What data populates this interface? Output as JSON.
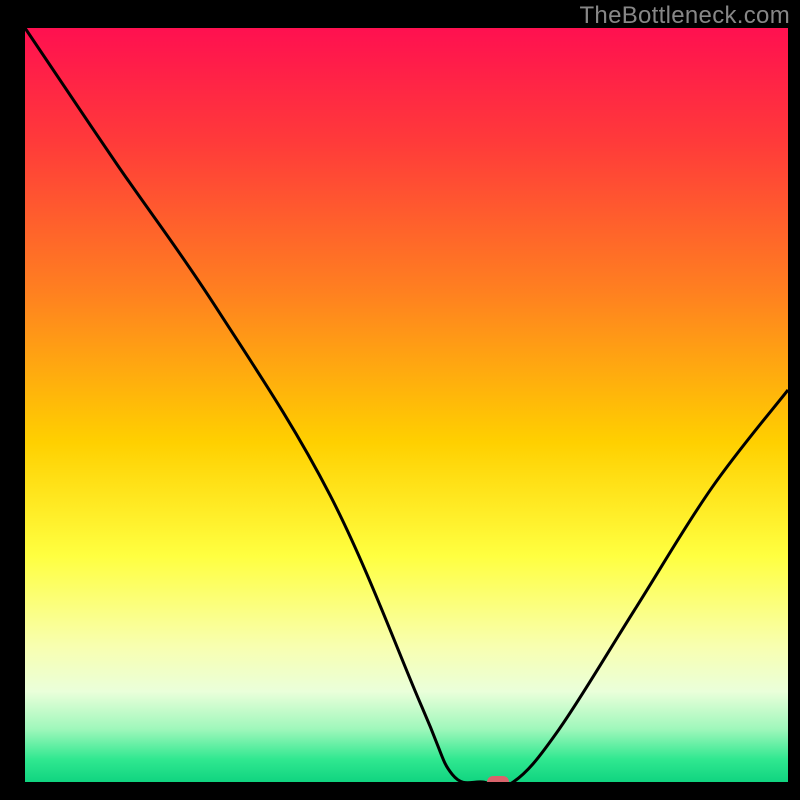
{
  "watermark": "TheBottleneck.com",
  "chart_data": {
    "type": "line",
    "title": "",
    "xlabel": "",
    "ylabel": "",
    "xlim": [
      0,
      100
    ],
    "ylim": [
      0,
      100
    ],
    "x": [
      0,
      12,
      25,
      40,
      52,
      56,
      60,
      64,
      70,
      80,
      90,
      100
    ],
    "values": [
      100,
      82,
      63,
      38,
      10,
      1,
      0,
      0,
      7,
      23,
      39,
      52
    ],
    "series_name": "bottleneck-curve",
    "marker": {
      "x": 62,
      "y": 0
    },
    "gradient_stops": [
      {
        "offset": 0.0,
        "color": "#ff1050"
      },
      {
        "offset": 0.15,
        "color": "#ff3a3a"
      },
      {
        "offset": 0.35,
        "color": "#ff8020"
      },
      {
        "offset": 0.55,
        "color": "#ffd000"
      },
      {
        "offset": 0.7,
        "color": "#ffff40"
      },
      {
        "offset": 0.82,
        "color": "#f8ffb0"
      },
      {
        "offset": 0.88,
        "color": "#eaffda"
      },
      {
        "offset": 0.93,
        "color": "#9ef7bb"
      },
      {
        "offset": 0.97,
        "color": "#30e890"
      },
      {
        "offset": 1.0,
        "color": "#10d480"
      }
    ],
    "frame": {
      "thickness_top": 28,
      "thickness_left": 25,
      "thickness_right": 12,
      "thickness_bottom": 18
    },
    "marker_style": {
      "fill": "#d9636b",
      "rx": 6,
      "w": 22,
      "h": 12
    }
  }
}
